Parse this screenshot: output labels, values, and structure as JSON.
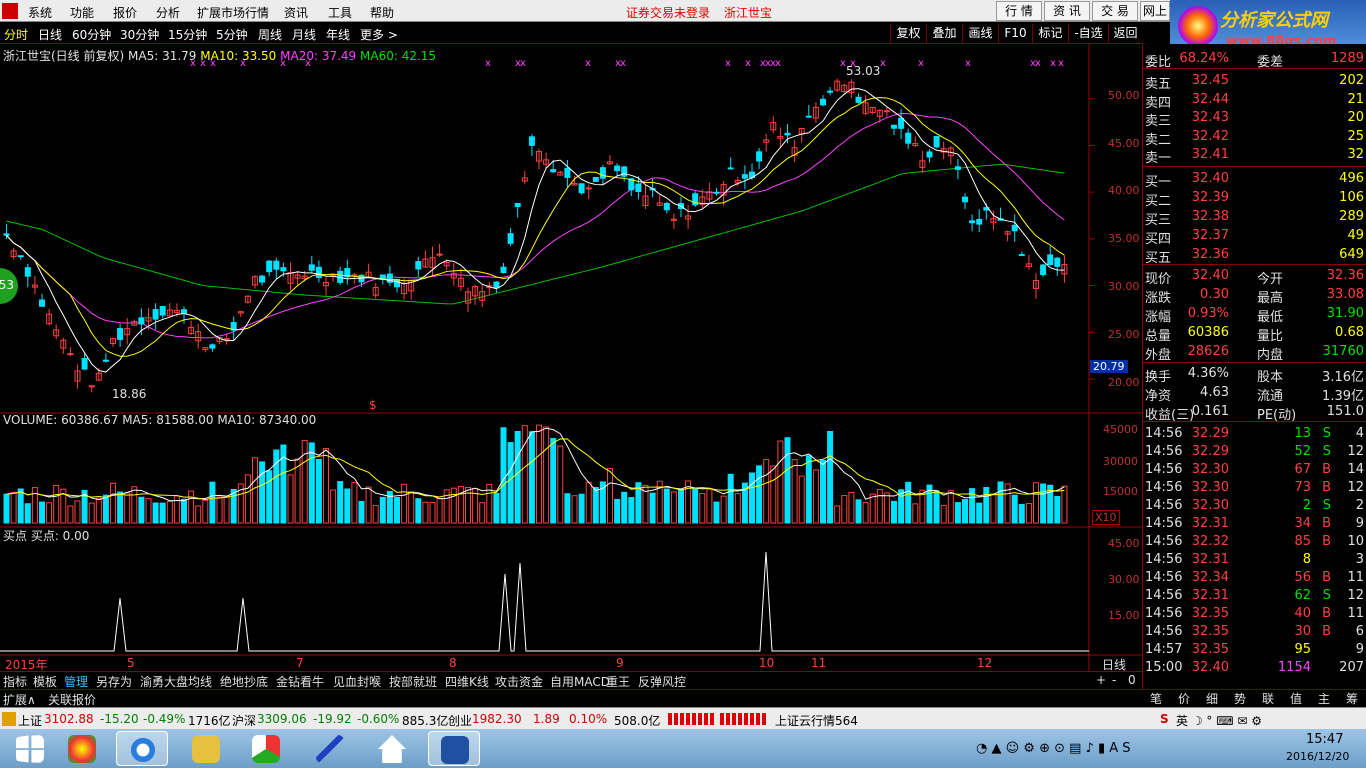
{
  "menu": {
    "items": [
      "系统",
      "功能",
      "报价",
      "分析",
      "扩展市场行情",
      "资讯",
      "工具",
      "帮助"
    ],
    "notice": "证券交易未登录",
    "stock_name": "浙江世宝",
    "right_tabs": [
      "行 情",
      "资 讯",
      "交 易",
      "网上"
    ]
  },
  "logo": {
    "title": "分析家公式网",
    "url": "www.88gs.com"
  },
  "periods": [
    "分时",
    "日线",
    "60分钟",
    "30分钟",
    "15分钟",
    "5分钟",
    "周线",
    "月线",
    "年线",
    "更多 >"
  ],
  "toolbar": [
    "复权",
    "叠加",
    "画线",
    "F10",
    "标记",
    "-自选",
    "返回"
  ],
  "chart_header": {
    "name": "浙江世宝(日线 前复权)",
    "ma5": "MA5: 31.79",
    "ma10": "MA10: 33.50",
    "ma20": "MA20: 37.49",
    "ma60": "MA60: 42.15"
  },
  "price_axis": [
    "50.00",
    "45.00",
    "40.00",
    "35.00",
    "30.00",
    "25.00",
    "20.00"
  ],
  "price_marker": "20.79",
  "high_label": "53.03",
  "low_label": "18.86",
  "badge": "53",
  "volume_header": {
    "label": "VOLUME: 60386.67",
    "ma5": "MA5: 81588.00",
    "ma10": "MA10: 87340.00"
  },
  "volume_axis": [
    "45000",
    "30000",
    "15000"
  ],
  "volume_unit": "X10",
  "indicator_header": "买点  买点: 0.00",
  "indicator_axis": [
    "45.00",
    "30.00",
    "15.00"
  ],
  "time_axis": {
    "year": "2015年",
    "months": [
      "5",
      "7",
      "8",
      "9",
      "10",
      "11",
      "12"
    ],
    "period": "日线"
  },
  "bottom_tabs": [
    "指标",
    "模板",
    "管理",
    "另存为",
    "渝勇大盘均线",
    "绝地抄底",
    "金钻看牛",
    "见血封喉",
    "按部就班",
    "四维K线",
    "攻击资金",
    "自用MACD",
    "重王",
    "反弹风控"
  ],
  "expand": {
    "a": "扩展∧",
    "b": "关联报价"
  },
  "quote": {
    "ratio": {
      "label": "委比",
      "value": "68.24%",
      "label2": "委差",
      "value2": "1289"
    },
    "asks": [
      {
        "label": "卖五",
        "price": "32.45",
        "vol": "202"
      },
      {
        "label": "卖四",
        "price": "32.44",
        "vol": "21"
      },
      {
        "label": "卖三",
        "price": "32.43",
        "vol": "20"
      },
      {
        "label": "卖二",
        "price": "32.42",
        "vol": "25"
      },
      {
        "label": "卖一",
        "price": "32.41",
        "vol": "32"
      }
    ],
    "bids": [
      {
        "label": "买一",
        "price": "32.40",
        "vol": "496"
      },
      {
        "label": "买二",
        "price": "32.39",
        "vol": "106"
      },
      {
        "label": "买三",
        "price": "32.38",
        "vol": "289"
      },
      {
        "label": "买四",
        "price": "32.37",
        "vol": "49"
      },
      {
        "label": "买五",
        "price": "32.36",
        "vol": "649"
      }
    ],
    "stats": [
      {
        "l1": "现价",
        "v1": "32.40",
        "l2": "今开",
        "v2": "32.36"
      },
      {
        "l1": "涨跌",
        "v1": "0.30",
        "l2": "最高",
        "v2": "33.08"
      },
      {
        "l1": "涨幅",
        "v1": "0.93%",
        "l2": "最低",
        "v2": "31.90"
      },
      {
        "l1": "总量",
        "v1": "60386",
        "l2": "量比",
        "v2": "0.68"
      },
      {
        "l1": "外盘",
        "v1": "28626",
        "l2": "内盘",
        "v2": "31760"
      }
    ],
    "fin": [
      {
        "l1": "换手",
        "v1": "4.36%",
        "l2": "股本",
        "v2": "3.16亿"
      },
      {
        "l1": "净资",
        "v1": "4.63",
        "l2": "流通",
        "v2": "1.39亿"
      },
      {
        "l1": "收益(三)",
        "v1": "0.161",
        "l2": "PE(动)",
        "v2": "151.0"
      }
    ],
    "ticks": [
      {
        "t": "14:56",
        "p": "32.29",
        "v": "13",
        "s": "S",
        "n": "4"
      },
      {
        "t": "14:56",
        "p": "32.29",
        "v": "52",
        "s": "S",
        "n": "12"
      },
      {
        "t": "14:56",
        "p": "32.30",
        "v": "67",
        "s": "B",
        "n": "14"
      },
      {
        "t": "14:56",
        "p": "32.30",
        "v": "73",
        "s": "B",
        "n": "12"
      },
      {
        "t": "14:56",
        "p": "32.30",
        "v": "2",
        "s": "S",
        "n": "2"
      },
      {
        "t": "14:56",
        "p": "32.31",
        "v": "34",
        "s": "B",
        "n": "9"
      },
      {
        "t": "14:56",
        "p": "32.32",
        "v": "85",
        "s": "B",
        "n": "10"
      },
      {
        "t": "14:56",
        "p": "32.31",
        "v": "8",
        "s": "",
        "n": "3"
      },
      {
        "t": "14:56",
        "p": "32.34",
        "v": "56",
        "s": "B",
        "n": "11"
      },
      {
        "t": "14:56",
        "p": "32.31",
        "v": "62",
        "s": "S",
        "n": "12"
      },
      {
        "t": "14:56",
        "p": "32.35",
        "v": "40",
        "s": "B",
        "n": "11"
      },
      {
        "t": "14:56",
        "p": "32.35",
        "v": "30",
        "s": "B",
        "n": "6"
      },
      {
        "t": "14:57",
        "p": "32.35",
        "v": "95",
        "s": "",
        "n": "9"
      },
      {
        "t": "15:00",
        "p": "32.40",
        "v": "1154",
        "s": "",
        "n": "207"
      }
    ]
  },
  "side_tabs": [
    "笔",
    "价",
    "细",
    "势",
    "联",
    "值",
    "主",
    "筹"
  ],
  "status": {
    "sh_label": "上证",
    "sh_val": "3102.88",
    "sh_chg": "-15.20",
    "sh_pct": "-0.49%",
    "sh_amt": "1716亿",
    "sz_label": "沪深",
    "sz_val": "3309.06",
    "sz_chg": "-19.92",
    "sz_pct": "-0.60%",
    "sz_amt": "885.3亿",
    "cy_label": "创业",
    "cy_val": "1982.30",
    "cy_chg": "1.89",
    "cy_pct": "0.10%",
    "cy_amt": "508.0亿",
    "cloud": "上证云行情564"
  },
  "clock": {
    "time": "15:47",
    "date": "2016/12/20"
  },
  "colors": {
    "up": "#ff4040",
    "down": "#00e0ff",
    "ma5": "#ffffff",
    "ma10": "#ffff00",
    "ma20": "#ff40ff",
    "ma60": "#00c000"
  },
  "chart_data": {
    "type": "candlestick",
    "price_range": [
      18.86,
      53.03
    ],
    "ma_last": {
      "ma5": 31.79,
      "ma10": 33.5,
      "ma20": 37.49,
      "ma60": 42.15
    },
    "volume_range": [
      0,
      45000
    ],
    "indicator_peaks": [
      24,
      24,
      35,
      40,
      45
    ]
  }
}
